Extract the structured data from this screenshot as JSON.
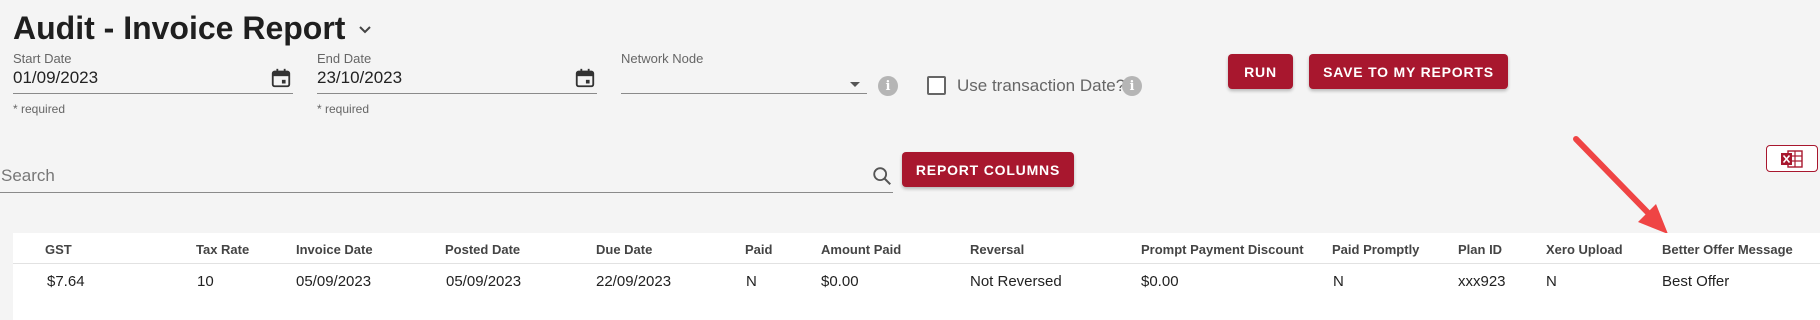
{
  "page": {
    "title": "Audit - Invoice Report"
  },
  "filters": {
    "start_date": {
      "label": "Start Date",
      "value": "01/09/2023",
      "hint": "* required"
    },
    "end_date": {
      "label": "End Date",
      "value": "23/10/2023",
      "hint": "* required"
    },
    "network_node": {
      "label": "Network Node",
      "value": ""
    },
    "use_transaction_date": {
      "label": "Use transaction Date?",
      "checked": false
    }
  },
  "actions": {
    "run_label": "RUN",
    "save_label": "SAVE TO MY REPORTS",
    "report_columns_label": "REPORT COLUMNS"
  },
  "search": {
    "placeholder": "Search"
  },
  "icons": {
    "title_dropdown": "chevron-down-icon",
    "calendar": "calendar-icon",
    "info": "info-icon",
    "search": "search-icon",
    "excel": "excel-export-icon",
    "annotation": "red-arrow"
  },
  "colors": {
    "accent": "#a8172e",
    "arrow": "#ef4444",
    "background": "#f4f4f4"
  },
  "table": {
    "columns": [
      "GST",
      "Tax Rate",
      "Invoice Date",
      "Posted Date",
      "Due Date",
      "Paid",
      "Amount Paid",
      "Reversal",
      "Prompt Payment Discount",
      "Paid Promptly",
      "Plan ID",
      "Xero Upload",
      "Better Offer Message"
    ],
    "rows": [
      [
        "$7.64",
        "10",
        "05/09/2023",
        "05/09/2023",
        "22/09/2023",
        "N",
        "$0.00",
        "Not Reversed",
        "$0.00",
        "N",
        "xxx923",
        "N",
        "Best Offer"
      ]
    ]
  }
}
